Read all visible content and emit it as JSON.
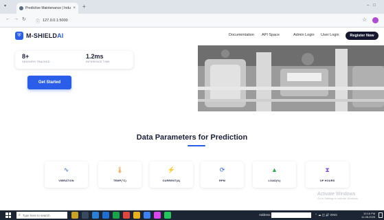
{
  "browser": {
    "tab_title": "Predictive Maintenance | Industr",
    "tab_close": "×",
    "new_tab": "+",
    "url": "127.0.0.1:5000"
  },
  "site": {
    "logo_main": "M-SHIELD",
    "logo_accent": "AI",
    "nav": {
      "documentation": "Documentation",
      "api_space": "API Space",
      "admin_login": "Admin Login",
      "user_login": "User Login",
      "register": "Register Now"
    },
    "stats": [
      {
        "value": "8+",
        "label": "SENSORS TRACKED"
      },
      {
        "value": "1.2ms",
        "label": "INFERENCE TIME"
      }
    ],
    "cta": "Get Started",
    "section_title": "Data Parameters for Prediction",
    "parameters": [
      {
        "label": "VIBRATION",
        "icon": "waveform-icon",
        "color": "#2a5ee8"
      },
      {
        "label": "TEMP(°C)",
        "icon": "thermometer-icon",
        "color": "#f28a1f"
      },
      {
        "label": "CURRENT(A)",
        "icon": "bolt-icon",
        "color": "#f2b91f"
      },
      {
        "label": "RPM",
        "icon": "sync-icon",
        "color": "#2a5ee8"
      },
      {
        "label": "LOAD(%)",
        "icon": "weight-icon",
        "color": "#2eaa4f"
      },
      {
        "label": "OP HOURS",
        "icon": "hourglass-icon",
        "color": "#8a4fd6"
      }
    ]
  },
  "watermark": {
    "title": "Activate Windows",
    "subtitle": "Go to Settings to activate Windows."
  },
  "taskbar": {
    "search_placeholder": "Type here to search",
    "address_label": "Address",
    "tray_text": "ENG",
    "time": "10:16 PM",
    "date": "11-08-2025"
  },
  "colors": {
    "accent": "#2a5ee8",
    "dark": "#14172e"
  }
}
